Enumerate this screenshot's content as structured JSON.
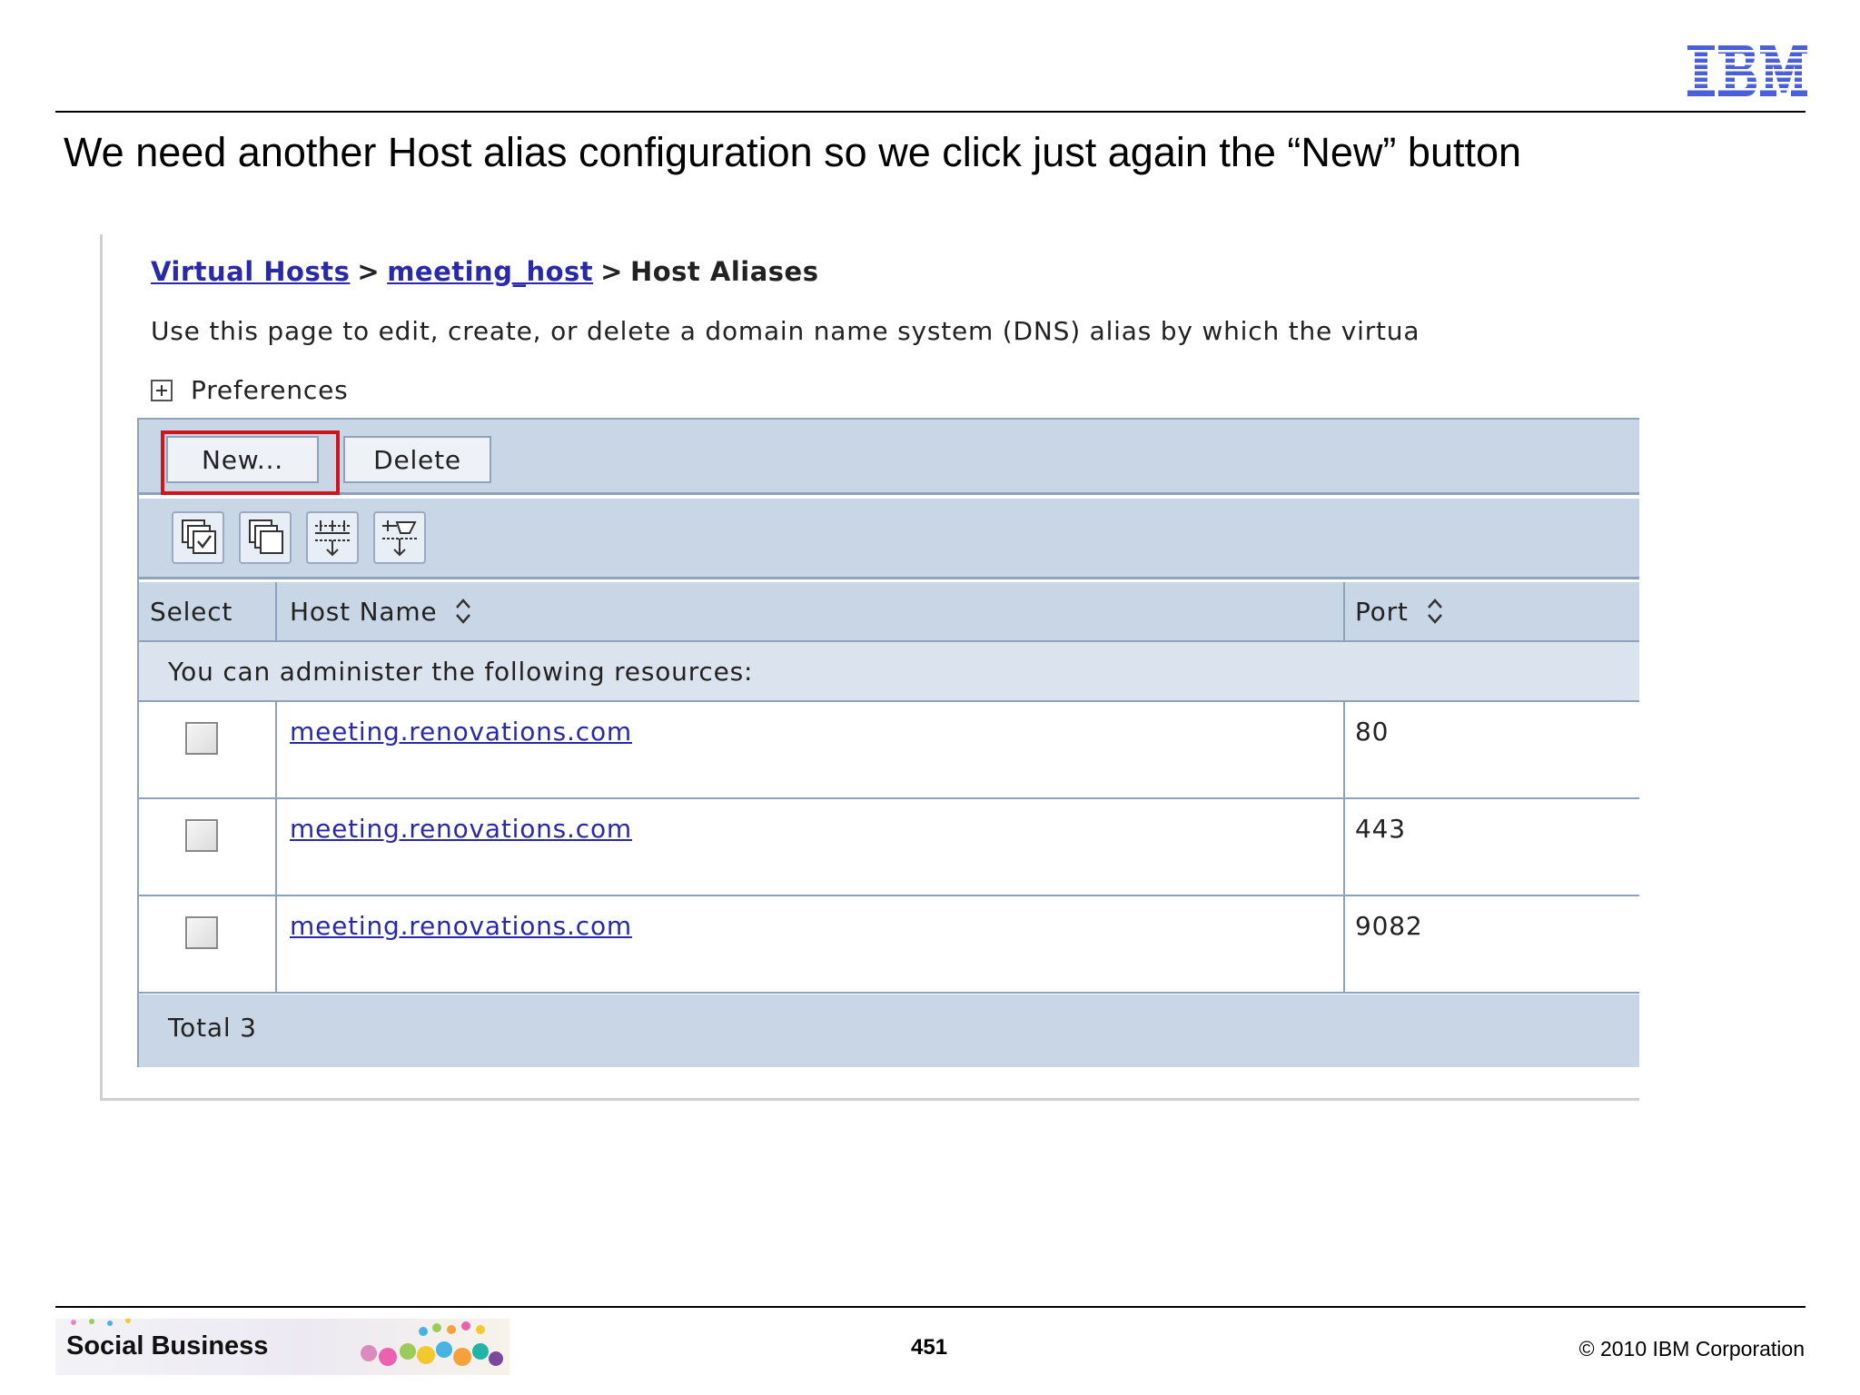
{
  "slide": {
    "title": "We need another Host alias configuration so we click just again the “New” button",
    "page_number": "451",
    "copyright": "© 2010 IBM Corporation",
    "footer_brand": "Social Business",
    "logo_alt": "IBM"
  },
  "breadcrumb": {
    "item1": "Virtual Hosts",
    "sep1": ">",
    "item2": "meeting_host",
    "sep2": ">",
    "current": "Host Aliases"
  },
  "description": "Use this page to edit, create, or delete a domain name system (DNS) alias by which the virtua",
  "preferences_label": "Preferences",
  "toolbar": {
    "new_label": "New...",
    "delete_label": "Delete",
    "icons": [
      "select-all-icon",
      "deselect-all-icon",
      "show-filter-icon",
      "clear-filter-icon"
    ]
  },
  "table": {
    "columns": {
      "select": "Select",
      "host": "Host Name",
      "port": "Port"
    },
    "notice": "You can administer the following resources:",
    "rows": [
      {
        "host": "meeting.renovations.com",
        "port": "80"
      },
      {
        "host": "meeting.renovations.com",
        "port": "443"
      },
      {
        "host": "meeting.renovations.com",
        "port": "9082"
      }
    ],
    "total": "Total 3"
  },
  "colors": {
    "link": "#2a2aa8",
    "panel_bg": "#c9d6e6",
    "highlight": "#d0141e",
    "ibm_blue": "#4b5fd6"
  }
}
